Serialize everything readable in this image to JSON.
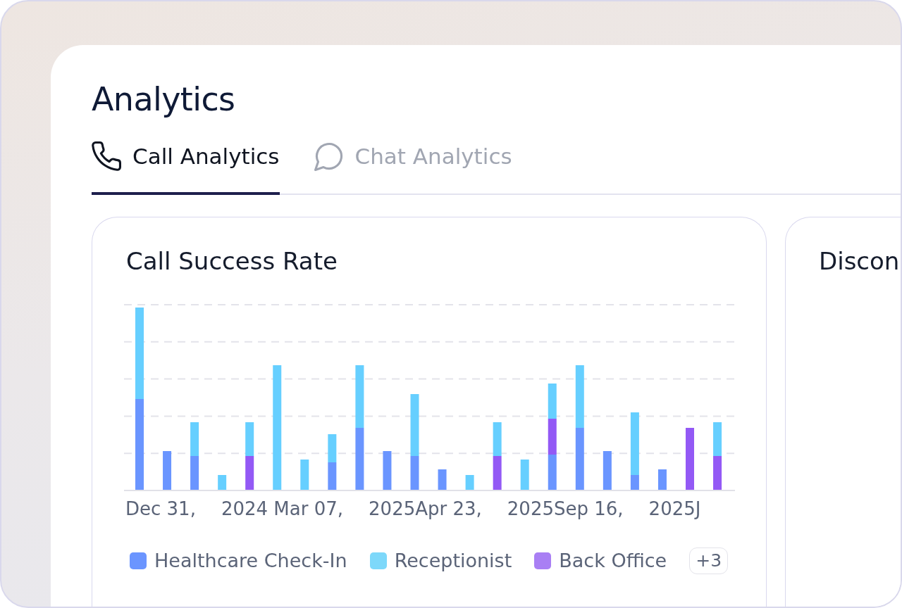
{
  "page": {
    "title": "Analytics"
  },
  "tabs": [
    {
      "label": "Call Analytics",
      "selected": true
    },
    {
      "label": "Chat Analytics",
      "selected": false
    }
  ],
  "cards": [
    {
      "title": "Call Success Rate",
      "x_axis_labels": [
        "Dec 31,",
        "2024 Mar 07,",
        "2025Apr 23,",
        "2025Sep 16,",
        "2025J"
      ],
      "legend": [
        {
          "label": "Healthcare Check-In",
          "color": "#6b95ff"
        },
        {
          "label": "Receptionist",
          "color": "#7dd8fa"
        },
        {
          "label": "Back Office",
          "color": "#a97ff4"
        }
      ],
      "legend_more": "+3"
    },
    {
      "title": "Discon"
    }
  ]
}
